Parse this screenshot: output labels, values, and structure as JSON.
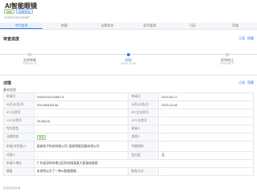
{
  "header": {
    "title": "AI智能眼镜",
    "tags": [
      "授权",
      "发明专利"
    ],
    "sub_id": "CN202311234567"
  },
  "tabs": [
    {
      "label": "专利信息",
      "active": true
    },
    {
      "label": "附图",
      "active": false
    },
    {
      "label": "法律状态",
      "active": false
    },
    {
      "label": "权利要求",
      "active": false
    },
    {
      "label": "引证",
      "active": false
    },
    {
      "label": "同族",
      "active": false
    }
  ],
  "timeline": {
    "title": "审查进度",
    "actions": [
      "订阅",
      "提醒"
    ],
    "steps": [
      {
        "label": "实质审查",
        "date": "2023-05-17",
        "active": false
      },
      {
        "label": "授权",
        "date": "2023-12-08",
        "active": true
      },
      {
        "label": "权利终止",
        "date": "2043-05-17",
        "active": false
      }
    ]
  },
  "info": {
    "title": "详情",
    "actions": [
      "订阅",
      "提醒"
    ],
    "subtitle": "基本信息",
    "rows": [
      [
        "申请号",
        "CN202311234567.8",
        "申请日",
        "2023-05-17"
      ],
      [
        "公开(公告)号",
        "CN116543210A",
        "公开(公告)日",
        "2023-12-08"
      ],
      [
        "IPC分类号",
        "-",
        "IPC主分类号",
        "-"
      ],
      [
        "LOC分类号",
        "15-06(14)",
        "CPC分类号",
        "-"
      ],
      [
        "专利类型",
        "-",
        "申请人",
        "-"
      ],
      [
        "法律状态",
        "有效",
        "发明人",
        "-"
      ],
      [
        "申请(专利权)人",
        "某某电子科技有限公司; 某某智能设备有限公司",
        "代理机构",
        "-"
      ],
      [
        "代理人",
        "-",
        "优先权",
        "无"
      ],
      [
        "申请人地址",
        "广东省深圳市南山区科技园某某大厦某座某楼",
        "",
        ""
      ],
      [
        "摘要",
        "本发明公开了一种AI智能眼镜...",
        "联系方式",
        "-"
      ]
    ]
  },
  "footer_note": "信息仅供参考"
}
